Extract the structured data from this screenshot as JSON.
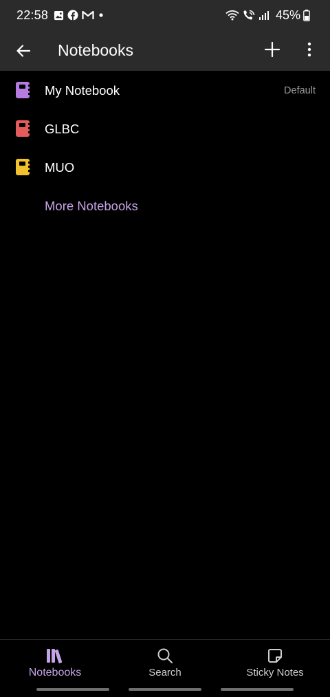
{
  "status_bar": {
    "time": "22:58",
    "battery_percent": "45%",
    "icons": [
      "gallery-icon",
      "facebook-icon",
      "gmail-icon",
      "dot-icon",
      "wifi-icon",
      "wifi-call-icon",
      "signal-icon",
      "battery-icon"
    ]
  },
  "app_bar": {
    "title": "Notebooks",
    "back_icon": "arrow-left-icon",
    "add_icon": "plus-icon",
    "more_icon": "vertical-dots-icon"
  },
  "notebooks": [
    {
      "name": "My Notebook",
      "badge": "Default",
      "color": "#b57be0"
    },
    {
      "name": "GLBC",
      "badge": "",
      "color": "#e35b5b"
    },
    {
      "name": "MUO",
      "badge": "",
      "color": "#f2c12e"
    }
  ],
  "more_notebooks_label": "More Notebooks",
  "colors": {
    "accent": "#c3a4e6",
    "appbar_bg": "#2b2b2b",
    "background": "#000000"
  },
  "bottom_nav": {
    "tabs": [
      {
        "label": "Notebooks",
        "icon": "books-icon",
        "active": true
      },
      {
        "label": "Search",
        "icon": "search-icon",
        "active": false
      },
      {
        "label": "Sticky Notes",
        "icon": "sticky-note-icon",
        "active": false
      }
    ]
  }
}
